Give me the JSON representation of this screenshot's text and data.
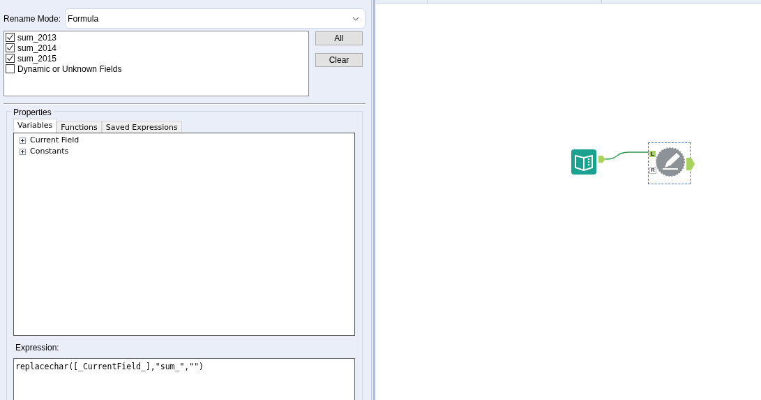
{
  "rename_mode": {
    "label": "Rename Mode:",
    "value": "Formula"
  },
  "fields": [
    {
      "label": "sum_2013",
      "checked": true
    },
    {
      "label": "sum_2014",
      "checked": true
    },
    {
      "label": "sum_2015",
      "checked": true
    },
    {
      "label": "Dynamic or Unknown Fields",
      "checked": false
    }
  ],
  "buttons": [
    "All",
    "Clear"
  ],
  "properties": {
    "title": "Properties",
    "tabs": [
      {
        "label": "Variables",
        "selected": true
      },
      {
        "label": "Functions",
        "selected": false
      },
      {
        "label": "Saved Expressions",
        "selected": false
      }
    ],
    "tree": [
      {
        "label": "Current Field",
        "expanded": false
      },
      {
        "label": "Constants",
        "expanded": false
      }
    ],
    "expression": {
      "label": "Expression:",
      "value": "replacechar([_CurrentField_],\"sum_\",\"\")"
    }
  },
  "canvas": {
    "anchors": [
      "L",
      "R"
    ]
  }
}
